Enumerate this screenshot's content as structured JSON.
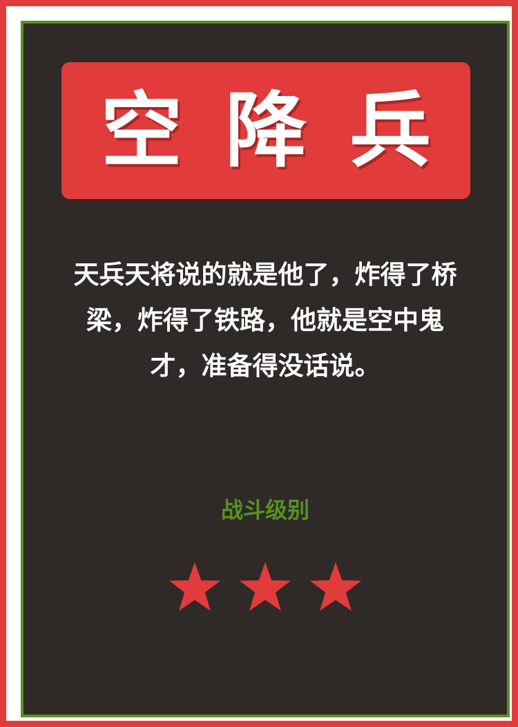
{
  "card": {
    "title": "空降兵",
    "description": "天兵天将说的就是他了，炸得了桥梁，炸得了铁路，他就是空中鬼才，准备得没话说。",
    "level_label": "战斗级别",
    "rating": 3,
    "rating_icon": "star-icon"
  },
  "colors": {
    "accent_red": "#e23b3b",
    "accent_green": "#56931f",
    "card_background": "#2f2a28",
    "text_white": "#ffffff"
  }
}
